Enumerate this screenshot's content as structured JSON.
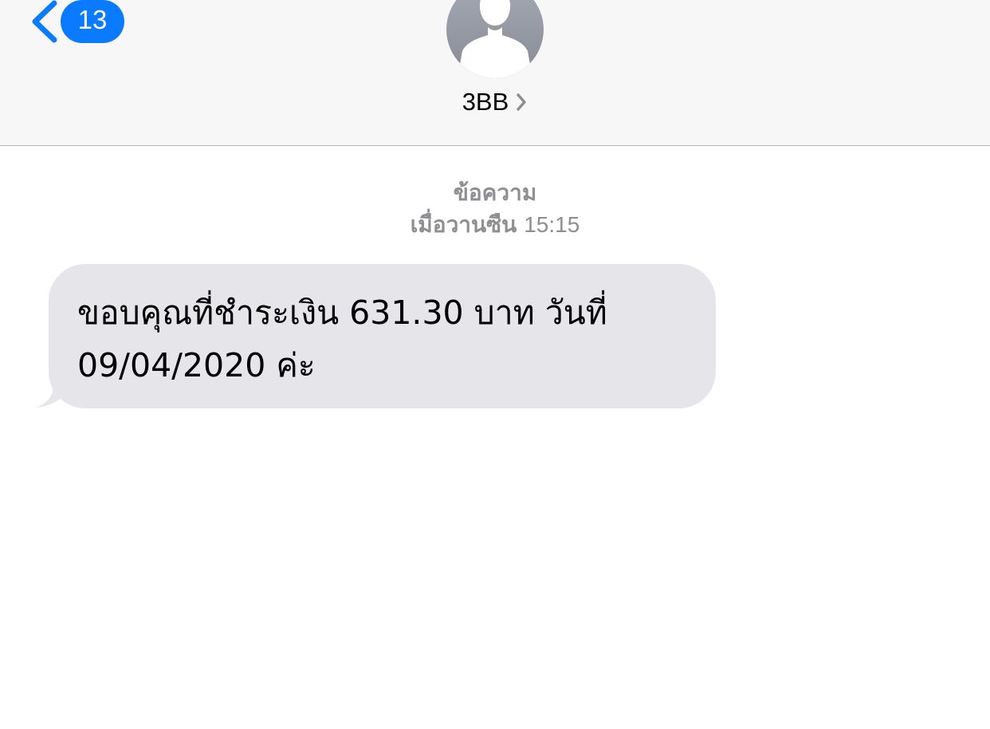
{
  "header": {
    "back_badge": "13",
    "contact_name": "3BB",
    "icons": {
      "back": "chevron-left-icon",
      "avatar": "person-silhouette-icon",
      "contact_details": "chevron-right-icon"
    },
    "colors": {
      "accent": "#0a7aff",
      "header_bg": "#f7f7f7"
    }
  },
  "conversation": {
    "service_label": "ข้อความ",
    "day_label": "เมื่อวานซืน",
    "time": "15:15",
    "messages": [
      {
        "direction": "incoming",
        "lines": [
          "ขอบคุณที่ชำระเงิน 631.30 บาท วันที่",
          "09/04/2020 ค่ะ"
        ],
        "bubble_color": "#e5e5ea"
      }
    ]
  }
}
